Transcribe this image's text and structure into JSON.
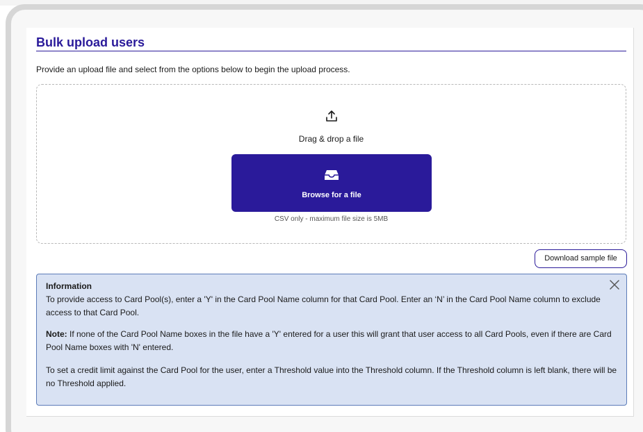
{
  "page": {
    "title": "Bulk upload users",
    "intro": "Provide an upload file and select from the options below to begin the upload process."
  },
  "dropzone": {
    "upload_icon": "upload-icon",
    "drag_text": "Drag & drop a file",
    "browse_icon": "inbox-tray-icon",
    "browse_label": "Browse for a file",
    "file_note": "CSV only - maximum file size is 5MB"
  },
  "actions": {
    "download_sample_label": "Download sample file"
  },
  "info": {
    "title": "Information",
    "close_icon": "close-icon",
    "paragraph1": "To provide access to Card Pool(s), enter a 'Y' in the Card Pool Name column for that Card Pool. Enter an ‘N’ in the Card Pool Name column to exclude access to that Card Pool.",
    "note_label": "Note:",
    "paragraph2": " If none of the Card Pool Name boxes in the file have a 'Y' entered for a user this will grant that user access to all Card Pools, even if there are Card Pool Name boxes with 'N' entered.",
    "paragraph3": "To set a credit limit against the Card Pool for the user, enter a Threshold value into the Threshold column. If the Threshold column is left blank, there will be no Threshold applied."
  },
  "colors": {
    "accent": "#2a1a9a",
    "info_background": "#d9e2f3",
    "info_border": "#5b7bb8"
  }
}
